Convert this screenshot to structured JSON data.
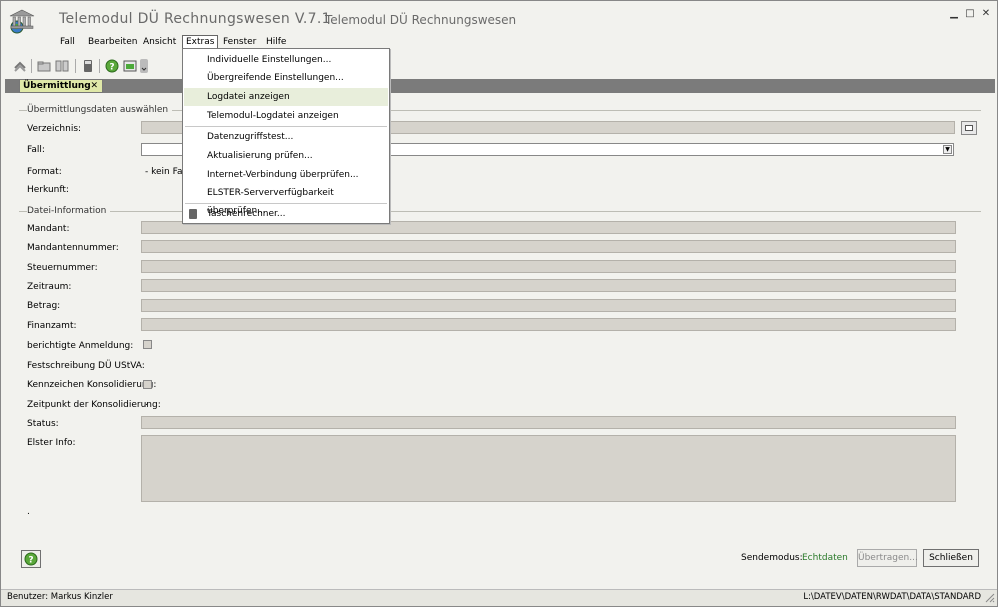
{
  "window": {
    "title": "Telemodul DÜ Rechnungswesen V.7.1",
    "subtitle": "Telemodul DÜ Rechnungswesen",
    "controls": {
      "minimize": "▁",
      "maximize": "□",
      "close": "✕"
    }
  },
  "menubar": {
    "items": [
      {
        "label": "Fall"
      },
      {
        "label": "Bearbeiten"
      },
      {
        "label": "Ansicht"
      },
      {
        "label": "Extras"
      },
      {
        "label": "Fenster"
      },
      {
        "label": "Hilfe"
      }
    ]
  },
  "extras_menu": {
    "items": [
      {
        "label": "Individuelle Einstellungen..."
      },
      {
        "label": "Übergreifende Einstellungen..."
      },
      {
        "label": "Logdatei anzeigen"
      },
      {
        "label": "Telemodul-Logdatei anzeigen"
      },
      {
        "label": "Datenzugriffstest..."
      },
      {
        "label": "Aktualisierung prüfen..."
      },
      {
        "label": "Internet-Verbindung überprüfen..."
      },
      {
        "label": "ELSTER-Serververfügbarkeit überprüfen..."
      },
      {
        "label": "Taschenrechner..."
      }
    ],
    "highlighted": "Logdatei anzeigen",
    "highlight_color": "#e8eedb"
  },
  "tab": {
    "label": "Übermittlung",
    "close": "✕"
  },
  "section1": {
    "title": "Übermittlungsdaten auswählen",
    "verzeichnis_label": "Verzeichnis:",
    "fall_label": "Fall:",
    "format_label": "Format:",
    "format_value": "- kein Fall",
    "herkunft_label": "Herkunft:"
  },
  "section2": {
    "title": "Datei-Information",
    "mandant_label": "Mandant:",
    "mandantennummer_label": "Mandantennummer:",
    "steuernummer_label": "Steuernummer:",
    "zeitraum_label": "Zeitraum:",
    "betrag_label": "Betrag:",
    "finanzamt_label": "Finanzamt:",
    "berichtigte_label": "berichtigte Anmeldung:",
    "festschreibung_label": "Festschreibung DÜ UStVA:",
    "kennzeichen_label": "Kennzeichen Konsolidierung:",
    "zeitpunkt_label": "Zeitpunkt der Konsolidierung:",
    "zeitpunkt_value": ".",
    "status_label": "Status:",
    "elster_label": "Elster Info:",
    "trailing_dot": "."
  },
  "footer": {
    "sendemodus_label": "Sendemodus:",
    "sendemodus_value": "Echtdaten",
    "sendemodus_color": "#2a7a2a",
    "uebertragen_button": "Übertragen...",
    "schliessen_button": "Schließen"
  },
  "statusbar": {
    "user": "Benutzer: Markus Kinzler",
    "path": "L:\\DATEV\\DATEN\\RWDAT\\DATA\\STANDARD"
  }
}
